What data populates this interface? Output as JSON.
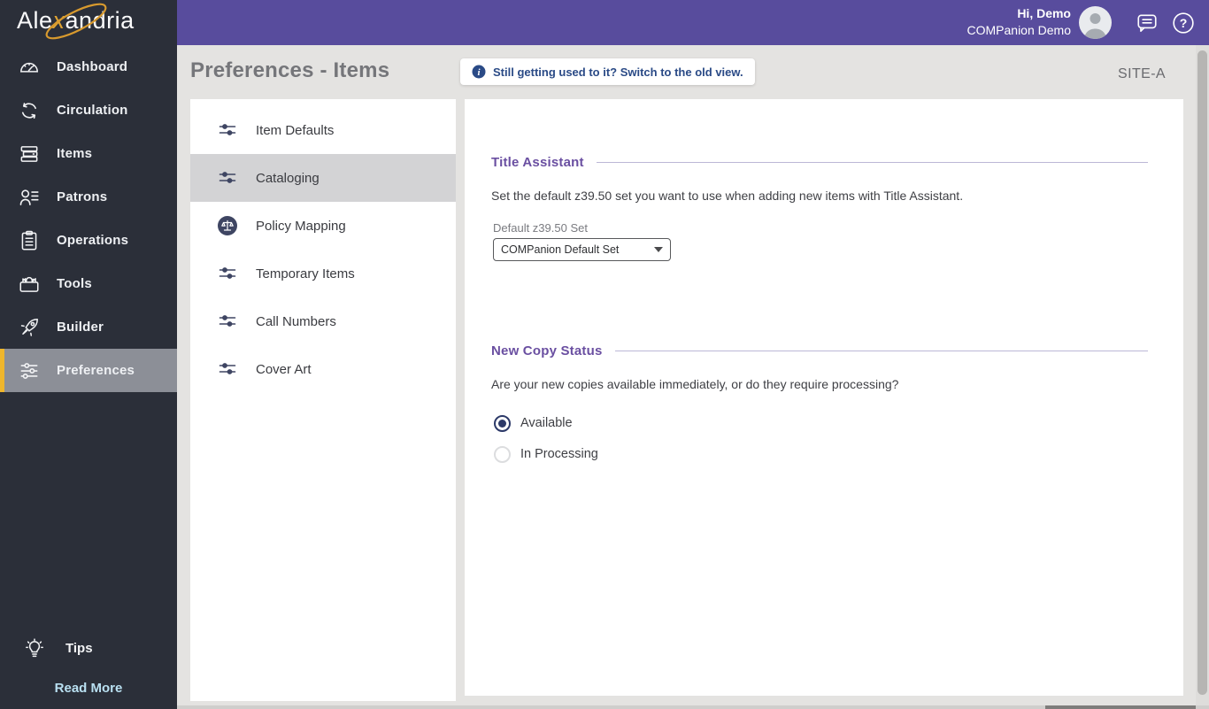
{
  "topbar": {
    "logo": {
      "part1": "Ale",
      "x": "x",
      "part2": "andria"
    },
    "greeting": "Hi, Demo",
    "account": "COMPanion Demo",
    "icons": [
      "avatar",
      "chat-icon",
      "help-icon"
    ]
  },
  "sidebar": {
    "items": [
      {
        "label": "Dashboard",
        "icon": "dashboard-icon",
        "selected": false
      },
      {
        "label": "Circulation",
        "icon": "circulation-icon",
        "selected": false
      },
      {
        "label": "Items",
        "icon": "items-icon",
        "selected": false
      },
      {
        "label": "Patrons",
        "icon": "patrons-icon",
        "selected": false
      },
      {
        "label": "Operations",
        "icon": "operations-icon",
        "selected": false
      },
      {
        "label": "Tools",
        "icon": "tools-icon",
        "selected": false
      },
      {
        "label": "Builder",
        "icon": "builder-icon",
        "selected": false
      },
      {
        "label": "Preferences",
        "icon": "preferences-icon",
        "selected": true
      }
    ],
    "tips_label": "Tips",
    "tips_icon": "lightbulb-icon",
    "read_more_label": "Read More"
  },
  "header": {
    "title": "Preferences - Items",
    "banner_text": "Still getting used to it? Switch to the old view.",
    "banner_icon": "info-icon",
    "site": "SITE-A"
  },
  "subnav": {
    "items": [
      {
        "label": "Item Defaults",
        "icon": "sliders-icon",
        "selected": false
      },
      {
        "label": "Cataloging",
        "icon": "sliders-icon",
        "selected": true
      },
      {
        "label": "Policy Mapping",
        "icon": "policy-scales-icon",
        "selected": false
      },
      {
        "label": "Temporary Items",
        "icon": "sliders-icon",
        "selected": false
      },
      {
        "label": "Call Numbers",
        "icon": "sliders-icon",
        "selected": false
      },
      {
        "label": "Cover Art",
        "icon": "sliders-icon",
        "selected": false
      }
    ]
  },
  "content": {
    "sections": [
      {
        "title": "Title Assistant",
        "description": "Set the default z39.50 set you want to use when adding new items with Title Assistant.",
        "field_label": "Default z39.50 Set",
        "field_value": "COMPanion Default Set"
      },
      {
        "title": "New Copy Status",
        "description": "Are your new copies available immediately, or do they require processing?",
        "options": [
          {
            "label": "Available",
            "selected": true
          },
          {
            "label": "In Processing",
            "selected": false
          }
        ]
      }
    ]
  },
  "colors": {
    "topbar_purple": "#584c9d",
    "sidebar_dark": "#2b2f39",
    "sidebar_selected_gray": "#8c8f97",
    "highlight_yellow": "#efb62c",
    "section_heading_purple": "#6a4fa1",
    "banner_blue": "#2a4a86",
    "radio_navy": "#2c3968",
    "read_more_blue": "#b9e0f1",
    "logo_gold": "#dfa434",
    "page_bg": "#e4e3e1"
  }
}
